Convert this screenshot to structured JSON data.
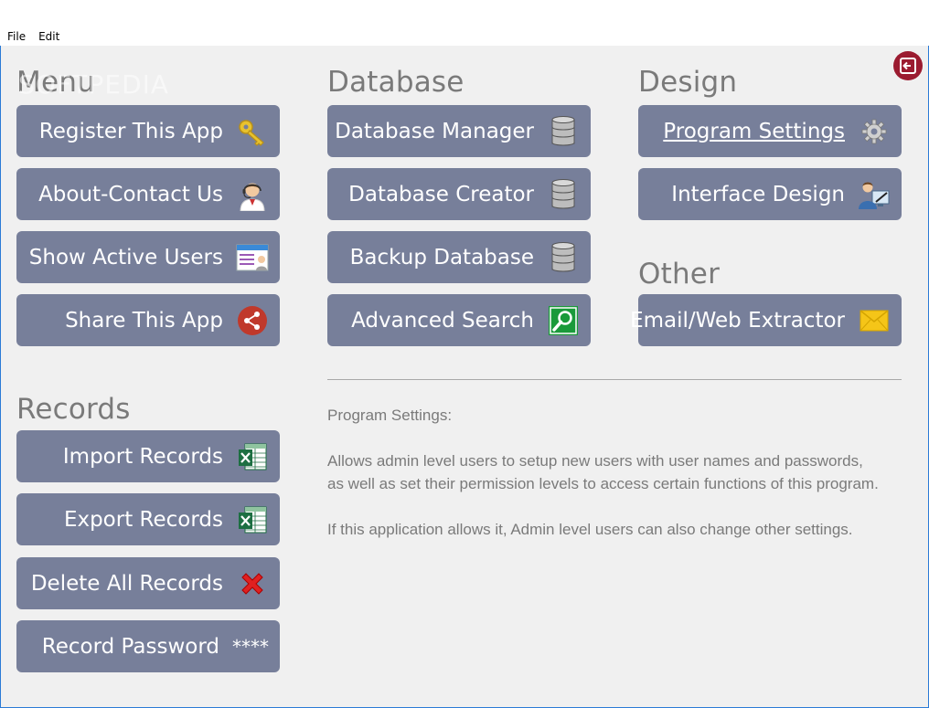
{
  "menubar": {
    "file": "File",
    "edit": "Edit"
  },
  "watermark": "SOFTPEDIA",
  "sections": {
    "menu": "Menu",
    "database": "Database",
    "design": "Design",
    "other": "Other",
    "records": "Records"
  },
  "menu_buttons": {
    "register": "Register This App",
    "about": "About-Contact Us",
    "active_users": "Show Active Users",
    "share": "Share This App"
  },
  "database_buttons": {
    "manager": "Database Manager",
    "creator": "Database Creator",
    "backup": "Backup Database",
    "search": "Advanced Search"
  },
  "design_buttons": {
    "settings": "Program Settings",
    "interface": "Interface Design"
  },
  "other_buttons": {
    "extractor": "Email/Web Extractor"
  },
  "records_buttons": {
    "import": "Import Records",
    "export": "Export Records",
    "delete": "Delete All Records",
    "password": "Record Password",
    "password_glyph": "****"
  },
  "description": {
    "heading": "Program Settings:",
    "line1": "Allows admin level users to setup new users with user names and passwords,",
    "line2": "as well as set their permission levels to access certain functions of this program.",
    "line3": "If this application allows it, Admin level users can also change other settings."
  },
  "colors": {
    "button_bg": "#777f9a",
    "section_text": "#7a7a7a",
    "exit_button": "#9b1b30",
    "window_border": "#2b7bd6"
  },
  "icons": {
    "register": "key-icon",
    "about": "support-agent-icon",
    "active_users": "user-list-icon",
    "share": "share-icon",
    "database": "database-icon",
    "search": "search-icon",
    "settings": "gear-icon",
    "interface": "designer-icon",
    "extractor": "envelope-icon",
    "excel": "excel-icon",
    "delete": "red-x-icon",
    "exit": "exit-icon"
  }
}
